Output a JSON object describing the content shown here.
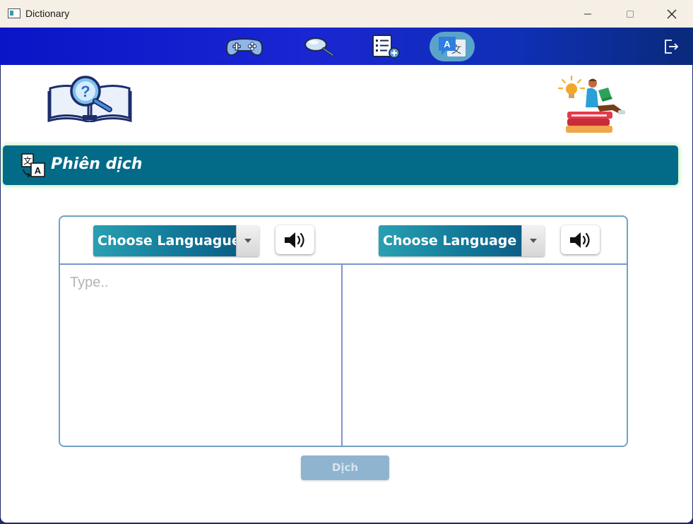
{
  "window": {
    "title": "Dictionary",
    "controls": [
      "minimize",
      "maximize",
      "close"
    ]
  },
  "navbar": {
    "items": [
      {
        "name": "game",
        "icon": "gamepad-icon"
      },
      {
        "name": "search",
        "icon": "magnifier-icon"
      },
      {
        "name": "word-list",
        "icon": "list-add-icon"
      },
      {
        "name": "translate",
        "icon": "translate-icon",
        "active": true
      }
    ],
    "logout_icon": "logout-icon"
  },
  "section": {
    "title": "Phiên dịch",
    "icon": "translate-icon"
  },
  "translator": {
    "source_language": "Choose Languague",
    "target_language": "Choose Language",
    "source_placeholder": "Type..",
    "source_text": "",
    "target_text": "",
    "translate_button": "Dịch"
  },
  "colors": {
    "navbar_start": "#0a15c7",
    "navbar_end": "#0a2a7a",
    "header": "#036b87",
    "select_accent": "#137c9b",
    "button_disabled": "#8fb4cf"
  }
}
